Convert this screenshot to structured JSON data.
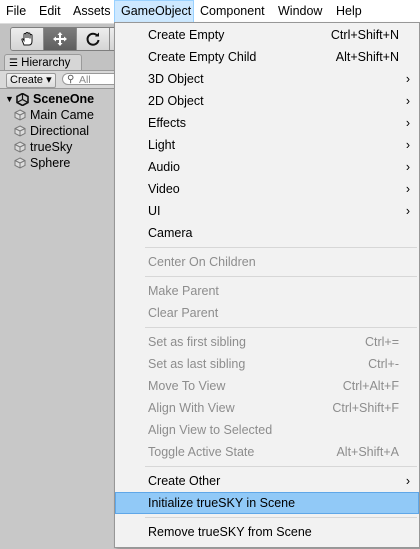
{
  "menubar": {
    "items": [
      "File",
      "Edit",
      "Assets",
      "GameObject",
      "Component",
      "Window",
      "Help"
    ]
  },
  "hierarchy": {
    "tab_label": "Hierarchy",
    "create_label": "Create ▾",
    "search_placeholder": "All",
    "scene_name": "SceneOne",
    "objects": [
      "Main Came",
      "Directional",
      "trueSky",
      "Sphere"
    ]
  },
  "menu": {
    "items": [
      {
        "label": "Create Empty",
        "shortcut": "Ctrl+Shift+N"
      },
      {
        "label": "Create Empty Child",
        "shortcut": "Alt+Shift+N"
      },
      {
        "label": "3D Object",
        "arrow": "›"
      },
      {
        "label": "2D Object",
        "arrow": "›"
      },
      {
        "label": "Effects",
        "arrow": "›"
      },
      {
        "label": "Light",
        "arrow": "›"
      },
      {
        "label": "Audio",
        "arrow": "›"
      },
      {
        "label": "Video",
        "arrow": "›"
      },
      {
        "label": "UI",
        "arrow": "›"
      },
      {
        "label": "Camera"
      },
      {
        "label": "Center On Children"
      },
      {
        "label": "Make Parent"
      },
      {
        "label": "Clear Parent"
      },
      {
        "label": "Set as first sibling",
        "shortcut": "Ctrl+="
      },
      {
        "label": "Set as last sibling",
        "shortcut": "Ctrl+-"
      },
      {
        "label": "Move To View",
        "shortcut": "Ctrl+Alt+F"
      },
      {
        "label": "Align With View",
        "shortcut": "Ctrl+Shift+F"
      },
      {
        "label": "Align View to Selected"
      },
      {
        "label": "Toggle Active State",
        "shortcut": "Alt+Shift+A"
      },
      {
        "label": "Create Other",
        "arrow": "›"
      },
      {
        "label": "Initialize trueSKY in Scene"
      },
      {
        "label": "Remove trueSKY from Scene"
      }
    ]
  },
  "colors": {
    "highlight": "#91c9f7",
    "disabled_text": "#8d8d8d",
    "menu_bg": "#f2f2f2"
  }
}
